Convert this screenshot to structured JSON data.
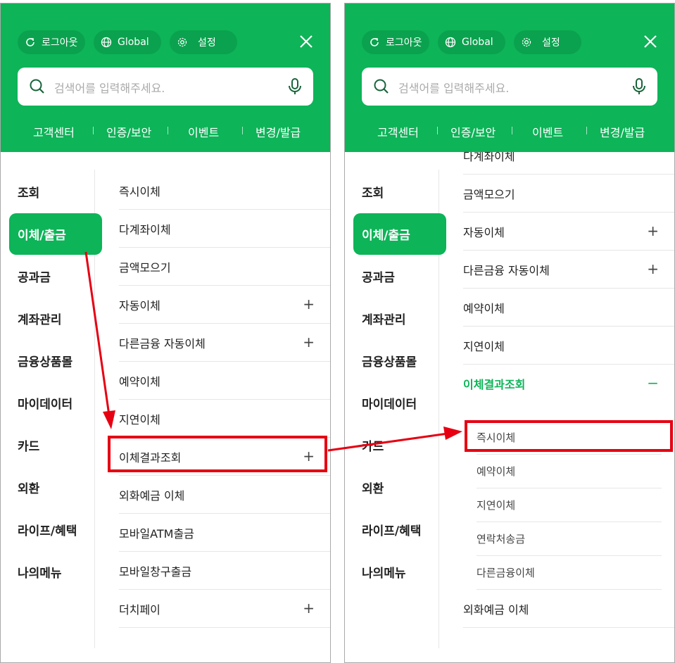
{
  "header": {
    "logout_label": "로그아웃",
    "global_label": "Global",
    "settings_label": "설정",
    "search_placeholder": "검색어를 입력해주세요.",
    "quick_links": [
      "고객센터",
      "인증/보안",
      "이벤트",
      "변경/발급"
    ]
  },
  "left_nav": [
    "조회",
    "이체/출금",
    "공과금",
    "계좌관리",
    "금융상품몰",
    "마이데이터",
    "카드",
    "외환",
    "라이프/혜택",
    "나의메뉴"
  ],
  "left_panel": {
    "submenu": [
      {
        "label": "즉시이체",
        "expand": ""
      },
      {
        "label": "다계좌이체",
        "expand": ""
      },
      {
        "label": "금액모으기",
        "expand": ""
      },
      {
        "label": "자동이체",
        "expand": "+"
      },
      {
        "label": "다른금융 자동이체",
        "expand": "+"
      },
      {
        "label": "예약이체",
        "expand": ""
      },
      {
        "label": "지연이체",
        "expand": ""
      },
      {
        "label": "이체결과조회",
        "expand": "+"
      },
      {
        "label": "외화예금 이체",
        "expand": ""
      },
      {
        "label": "모바일ATM출금",
        "expand": ""
      },
      {
        "label": "모바일창구출금",
        "expand": ""
      },
      {
        "label": "더치페이",
        "expand": "+"
      }
    ]
  },
  "right_panel": {
    "submenu": [
      {
        "label": "다계좌이체",
        "expand": ""
      },
      {
        "label": "금액모으기",
        "expand": ""
      },
      {
        "label": "자동이체",
        "expand": "+"
      },
      {
        "label": "다른금융 자동이체",
        "expand": "+"
      },
      {
        "label": "예약이체",
        "expand": ""
      },
      {
        "label": "지연이체",
        "expand": ""
      },
      {
        "label": "이체결과조회",
        "expand": "−"
      }
    ],
    "expanded_items": [
      "즉시이체",
      "예약이체",
      "지연이체",
      "연락처송금",
      "다른금융이체"
    ],
    "after_item": "외화예금 이체"
  },
  "colors": {
    "brand_green": "#0db458",
    "highlight_red": "#e60012"
  }
}
